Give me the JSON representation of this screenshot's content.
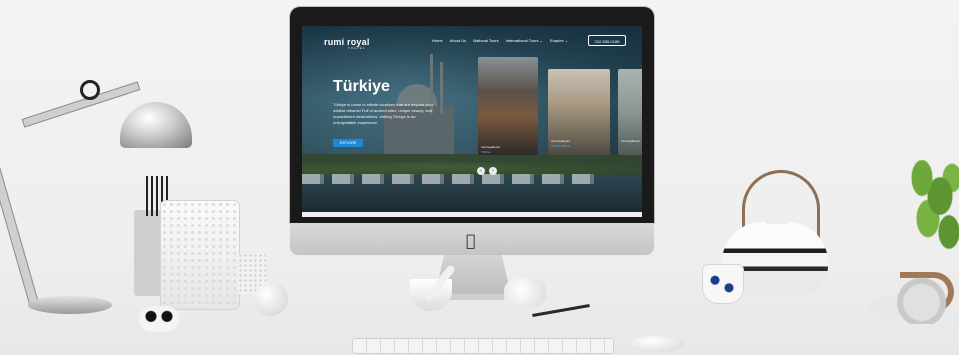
{
  "site": {
    "logo": "rumi royal",
    "logo_sub": "TRAVEL",
    "nav": [
      "Home",
      "About Us",
      "National Tours",
      "International Tours ⌄",
      "Enquire ⌄"
    ],
    "phone": "202-555-0188"
  },
  "hero": {
    "title": "Türkiye",
    "text": "Türkiye is home to infinite locations that are beyond your wildest dreams! Full of ancient sites, unique beauty, and unparalleled destinations, visiting Türkiye is an unforgettable experience.",
    "button": "EXPLORE"
  },
  "cards": [
    {
      "caption": "rumiroyaltours",
      "tag": "Türkiye"
    },
    {
      "caption": "rumiroyaltours",
      "tag": "Türkiye-Bursa"
    },
    {
      "caption": "rumiroyaltours",
      "tag": ""
    }
  ],
  "slider": {
    "prev": "‹",
    "next": "›"
  },
  "icons": {
    "apple": "apple-logo"
  }
}
